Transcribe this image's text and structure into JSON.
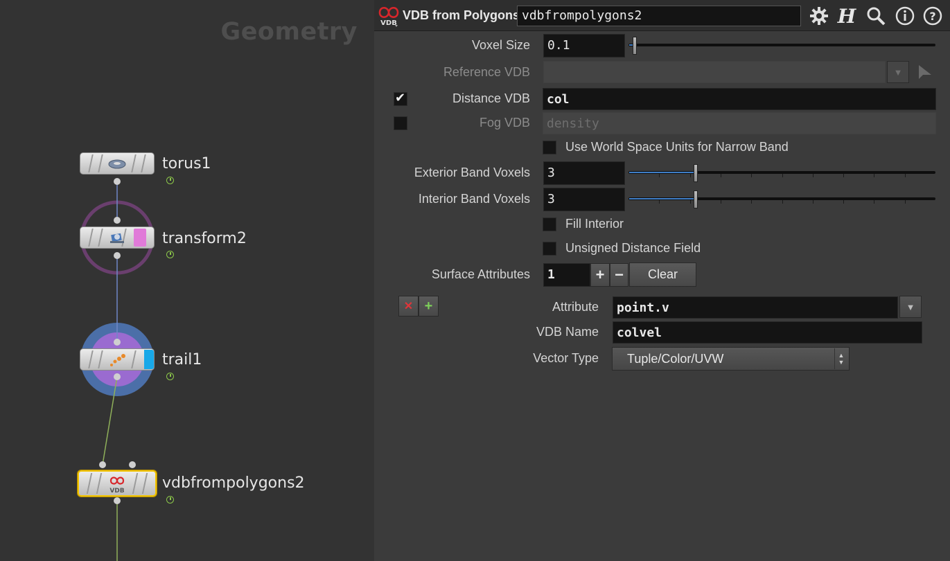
{
  "network": {
    "title": "Geometry",
    "nodes": [
      {
        "name": "torus1"
      },
      {
        "name": "transform2"
      },
      {
        "name": "trail1"
      },
      {
        "name": "vdbfrompolygons2"
      }
    ]
  },
  "header": {
    "icon_text": "VDB",
    "node_type": "VDB from Polygons",
    "node_name": "vdbfrompolygons2",
    "buttons": [
      "gear-icon",
      "houdini-help-icon",
      "search-icon",
      "info-icon",
      "help-icon"
    ]
  },
  "params": {
    "voxel_size": {
      "label": "Voxel Size",
      "value": "0.1",
      "slider_fraction": 0.02
    },
    "reference_vdb": {
      "label": "Reference VDB",
      "value": ""
    },
    "distance_vdb": {
      "label": "Distance VDB",
      "value": "col",
      "checked": true,
      "check_glyph": "✔"
    },
    "fog_vdb": {
      "label": "Fog VDB",
      "placeholder": "density",
      "checked": false
    },
    "world_space": {
      "label": "Use World Space Units for Narrow Band",
      "checked": false
    },
    "exterior_band": {
      "label": "Exterior Band Voxels",
      "value": "3",
      "slider_fraction": 0.22
    },
    "interior_band": {
      "label": "Interior Band Voxels",
      "value": "3",
      "slider_fraction": 0.22
    },
    "fill_interior": {
      "label": "Fill Interior",
      "checked": false
    },
    "unsigned_df": {
      "label": "Unsigned Distance Field",
      "checked": false
    },
    "surface_attributes": {
      "label": "Surface Attributes",
      "value": "1",
      "add": "+",
      "remove": "−",
      "clear": "Clear"
    },
    "multiparm": {
      "remove_glyph": "✕",
      "insert_glyph": "+"
    },
    "attribute": {
      "label": "Attribute",
      "value": "point.v"
    },
    "vdb_name": {
      "label": "VDB Name",
      "value": "colvel"
    },
    "vector_type": {
      "label": "Vector Type",
      "value": "Tuple/Color/UVW"
    }
  },
  "colors": {
    "accent_blue": "#3f7ec8",
    "selected_yellow": "#f2c400",
    "vdb_red": "#d8262b"
  }
}
